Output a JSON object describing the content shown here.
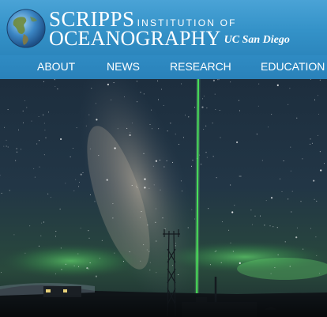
{
  "logo": {
    "line1_big": "SCRIPPS",
    "line1_small": "INSTITUTION OF",
    "line2_big": "OCEANOGRAPHY",
    "line2_tag": "UC San Diego"
  },
  "nav": {
    "items": [
      "ABOUT",
      "NEWS",
      "RESEARCH",
      "EDUCATION"
    ]
  },
  "icons": {
    "globe": "globe-icon"
  },
  "colors": {
    "header": "#3492c8",
    "nav": "#2c86bd",
    "laser": "#39e84a",
    "aurora": "#48c25a"
  }
}
